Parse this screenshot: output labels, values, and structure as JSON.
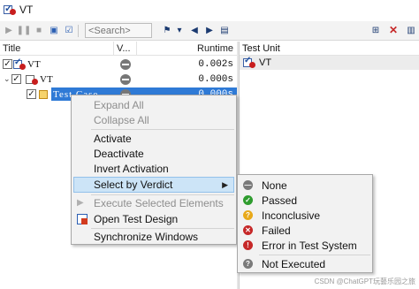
{
  "window": {
    "title": "VT"
  },
  "toolbar": {
    "search_placeholder": "<Search>",
    "search_value": ""
  },
  "tree": {
    "columns": {
      "title": "Title",
      "verdict": "V...",
      "runtime": "Runtime"
    },
    "rows": [
      {
        "label": "VT",
        "runtime": "0.002s",
        "expanded": true,
        "checked": true,
        "level": 0
      },
      {
        "label": "VT",
        "runtime": "0.000s",
        "expanded": true,
        "checked": true,
        "level": 1
      },
      {
        "label": "Test Case",
        "runtime": "0.000s",
        "checked": true,
        "level": 2,
        "selected": true
      }
    ]
  },
  "test_unit": {
    "header": "Test Unit",
    "item": "VT"
  },
  "context_menu": {
    "items": [
      {
        "label": "Expand All",
        "disabled": true
      },
      {
        "label": "Collapse All",
        "disabled": true
      },
      {
        "label": "Activate"
      },
      {
        "label": "Deactivate"
      },
      {
        "label": "Invert Activation"
      },
      {
        "label": "Select by Verdict",
        "submenu": true,
        "highlighted": true
      },
      {
        "label": "Execute Selected Elements",
        "disabled": true
      },
      {
        "label": "Open Test Design"
      },
      {
        "label": "Synchronize Windows"
      }
    ]
  },
  "verdict_submenu": {
    "items": [
      {
        "label": "None",
        "icon": "none-icon",
        "color": "#7a7a7a"
      },
      {
        "label": "Passed",
        "icon": "passed-icon",
        "color": "#2e9c2e"
      },
      {
        "label": "Inconclusive",
        "icon": "inconclusive-icon",
        "color": "#e8a91a"
      },
      {
        "label": "Failed",
        "icon": "failed-icon",
        "color": "#c62828"
      },
      {
        "label": "Error in Test System",
        "icon": "error-icon",
        "color": "#c62828"
      },
      {
        "label": "Not Executed",
        "icon": "not-executed-icon",
        "color": "#7a7a7a"
      }
    ]
  },
  "watermark": "CSDN @ChatGPT玩藝乐园之旅",
  "colors": {
    "selection": "#2f7ad6",
    "menu_hover": "#cce4f7"
  }
}
